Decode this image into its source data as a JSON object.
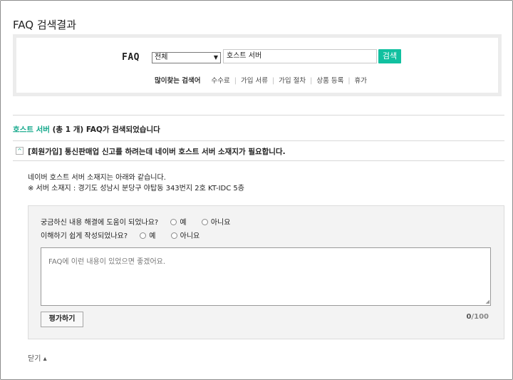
{
  "page": {
    "title": "FAQ 검색결과"
  },
  "search": {
    "label": "FAQ",
    "category": "전체",
    "category_arrow": "▼",
    "query": "호스트 서버",
    "button": "검색",
    "popular_title": "많이찾는 검색어",
    "popular_keywords": [
      "수수료",
      "가입 서류",
      "가입 절차",
      "상품 등록",
      "휴가"
    ]
  },
  "result": {
    "keyword": "호스트 서버",
    "count_text": "(총 1 개) FAQ가 검색되었습니다"
  },
  "faq_item": {
    "toggle": "^",
    "question": "[회원가입] 통신판매업 신고를 하려는데 네이버 호스트 서버 소재지가 필요합니다.",
    "answer_line1": "네이버 호스트 서버 소재지는 아래와 같습니다.",
    "answer_line2": "※ 서버 소재지 : 경기도 성남시 분당구 야탑동 343번지 2호 KT-IDC 5층"
  },
  "feedback": {
    "q1": "궁금하신 내용 해결에 도움이 되었나요?",
    "q2": "이해하기 쉽게 작성되었나요?",
    "yes": "예",
    "no": "아니요",
    "placeholder": "FAQ에 이런 내용이 있었으면 좋겠어요.",
    "submit": "평가하기",
    "count_current": "0",
    "count_max": "/100"
  },
  "close": {
    "label": "닫기 ▴"
  },
  "colors": {
    "accent": "#11c0a0",
    "accent_text": "#11a78a"
  }
}
